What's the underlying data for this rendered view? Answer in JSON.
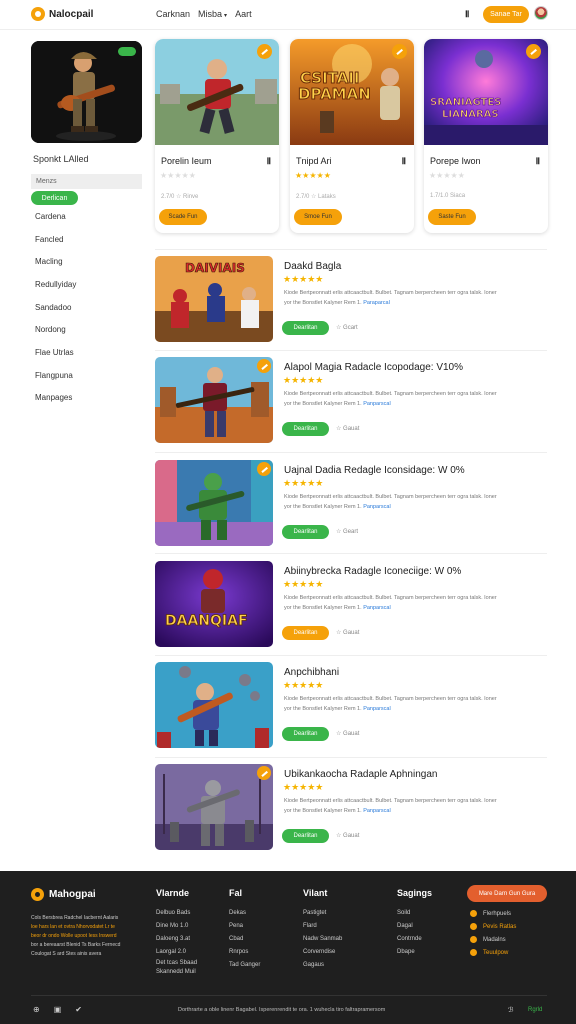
{
  "header": {
    "logo_text": "Nalocpail",
    "nav": [
      "Carknan",
      "Misba",
      "Aart"
    ],
    "icon": "Ⅱ",
    "cta_label": "Sanae Tar"
  },
  "sidebar": {
    "title": "Sponkt LAlled",
    "tag": "Menzs",
    "active_label": "Derlican",
    "items": [
      "Cardena",
      "Fancled",
      "Macling",
      "Redullyiday",
      "Sandadoo",
      "Nordong",
      "Flae Utrlas",
      "Flangpuna",
      "Manpages"
    ]
  },
  "cards": [
    {
      "title": "Porelin Ieum",
      "icon": "Ⅱ",
      "stars": "★★★★★",
      "stars_muted": true,
      "meta": "2.7/0 ☆  Rinve",
      "button": "Scade Fun"
    },
    {
      "title": "Tnipd Ari",
      "icon": "Ⅱ",
      "stars": "★★★★★",
      "stars_muted": false,
      "meta": "2.7/0 ☆  Lataks",
      "button": "Smoe Fun",
      "art_text_1": "CSITAII",
      "art_text_2": "DPAMAN"
    },
    {
      "title": "Porepe Iwon",
      "icon": "Ⅱ",
      "stars": "★★★★★",
      "stars_muted": true,
      "meta": "1.7/1.0  Siaca",
      "button": "Saste Fun",
      "art_text_1": "SRANIAGTES",
      "art_text_2": "LIANARAS"
    }
  ],
  "list": [
    {
      "title": "Daakd Bagla",
      "stars": "★★★★★",
      "desc": "Kiode Bertpeonnatt erlis attcaactbult. Bulbet. Tagnam berpercheen terr ogra talsk. Ioner",
      "desc2": "yor the Bonstlet Kalyner Rem 1. ",
      "desc_link": "Paraparcal",
      "button": "Dearlitan",
      "button_color": "green",
      "meta": "☆ Gcart",
      "art_text": "DAIVIAIS"
    },
    {
      "title": "Alapol Magia Radacle Icopodage: V10%",
      "stars": "★★★★★",
      "desc": "Kiode Bertpeonnatt erlis attcaactbult. Bulbet. Tagnam berpercheen terr ogra talsk. Ioner",
      "desc2": "yor the Bonstlet Kalyner Rem 1. ",
      "desc_link": "Panparscal",
      "button": "Dearlitan",
      "button_color": "green",
      "meta": "☆ Gauat"
    },
    {
      "title": "Uajnal Dadia Redagle Iconsidage: W 0%",
      "stars": "★★★★★",
      "desc": "Kiode Bertpeonnatt erlis attcaactbult. Bulbet. Tagnam berpercheen terr ogra talsk. Ioner",
      "desc2": "yor the Bonstlet Kalyner Rem 1. ",
      "desc_link": "Panparscal",
      "button": "Dearlitan",
      "button_color": "green",
      "meta": "☆ Geart"
    },
    {
      "title": "Abiinybrecka Radagle Iconeciige: W 0%",
      "stars": "★★★★★",
      "desc": "Kiode Bertpeonnatt erlis attcaactbult. Bulbet. Tagnam berpercheen terr ogra talsk. Ioner",
      "desc2": "yor the Bonstlet Kalyner Rem 1. ",
      "desc_link": "Panparscal",
      "button": "Dearlitan",
      "button_color": "orange",
      "meta": "☆ Gauat",
      "art_text": "DAANQIAF"
    },
    {
      "title": "Anpchibhani",
      "stars": "★★★★★",
      "desc": "Kiode Bertpeonnatt erlis attcaactbult. Bulbet. Tagnam berpercheen terr ogra talsk. Ioner",
      "desc2": "yor the Bonstlet Kalyner Rem 1. ",
      "desc_link": "Panparscal",
      "button": "Dearlitan",
      "button_color": "green",
      "meta": "☆ Gauat"
    },
    {
      "title": "Ubikankaocha Radaple Aphningan",
      "stars": "★★★★★",
      "desc": "Kiode Bertpeonnatt erlis attcaactbult. Bulbet. Tagnam berpercheen terr ogra talsk. Ioner",
      "desc2": "yor the Bonstlet Kalyner Rem 1. ",
      "desc_link": "Panparscal",
      "button": "Dearlitan",
      "button_color": "green",
      "meta": "☆ Gauat"
    }
  ],
  "footer": {
    "logo_text": "Mahogpai",
    "about_1": "Cols Bersbrea Radchel Iacbernt Aalaris",
    "about_2": "loe hars lan et ovtra Nhorvodatet Lr te",
    "about_3": "beor dr ondo Wolle upoot Iess Inswerd",
    "about_4": "bor a bereaarst Blenid Ts Barks Fernecd",
    "about_5": "Coulogat S ard Stes ainis avera",
    "columns": [
      {
        "head": "Vlarnde",
        "links": [
          "Delbuo Bads",
          "Dine Mo 1.0",
          "Daloeng 3.at",
          "Laorgal 2.0",
          "Det tcas Sbaad",
          "Skannedd Muil"
        ]
      },
      {
        "head": "Fal",
        "links": [
          "Dekas",
          "Pena",
          "Cbad",
          "Rnrpos",
          "Tad Ganger"
        ]
      },
      {
        "head": "Vilant",
        "links": [
          "Pastigtet",
          "Flard",
          "Nadw Sanmab",
          "Corverndise",
          "Gagaus"
        ]
      },
      {
        "head": "Sagings",
        "links": [
          "Soild",
          "Dagal",
          "Contrnde",
          "Dbape"
        ]
      }
    ],
    "button": "Mare Darn Gun Gura",
    "social": [
      "Flerhpuels",
      "Pevis Ratlas",
      "Madalns",
      "Teuulpow"
    ],
    "bottom_icons": [
      "⊕",
      "▣",
      "✔"
    ],
    "copyright": "Dorthrarte a oble linenr Bagabel. Isperenrendit te ora. 1 wuhecla tiro faltrapramersom",
    "right_icon": "ℬ",
    "right_link": "Rgrld"
  },
  "colors": {
    "accent_orange": "#f5a10a",
    "accent_green": "#3ab54a",
    "footer_bg": "#1f1f1f",
    "link_blue": "#2a7ad9"
  }
}
